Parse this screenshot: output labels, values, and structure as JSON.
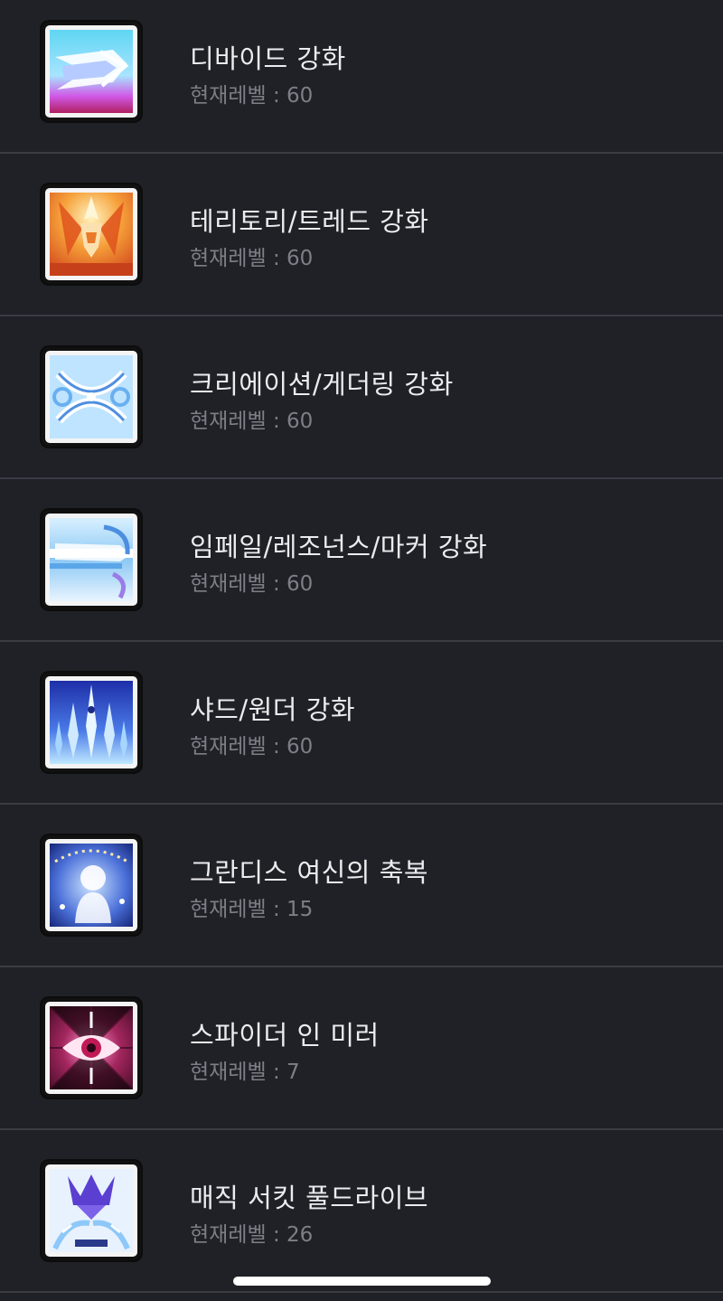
{
  "skills": [
    {
      "icon": "divide-boost-icon",
      "name": "디바이드 강화",
      "level_text": "현재레벨 : 60"
    },
    {
      "icon": "territory-trend-boost-icon",
      "name": "테리토리/트레드 강화",
      "level_text": "현재레벨 : 60"
    },
    {
      "icon": "creation-gathering-boost-icon",
      "name": "크리에이션/게더링 강화",
      "level_text": "현재레벨 : 60"
    },
    {
      "icon": "impale-resonance-marker-boost-icon",
      "name": "임페일/레조넌스/마커 강화",
      "level_text": "현재레벨 : 60"
    },
    {
      "icon": "shard-wonder-boost-icon",
      "name": "샤드/원더 강화",
      "level_text": "현재레벨 : 60"
    },
    {
      "icon": "grandis-goddess-blessing-icon",
      "name": "그란디스 여신의 축복",
      "level_text": "현재레벨 : 15"
    },
    {
      "icon": "spider-in-mirror-icon",
      "name": "스파이더 인 미러",
      "level_text": "현재레벨 : 7"
    },
    {
      "icon": "magic-circuit-full-drive-icon",
      "name": "매직 서킷 풀드라이브",
      "level_text": "현재레벨 : 26"
    }
  ]
}
